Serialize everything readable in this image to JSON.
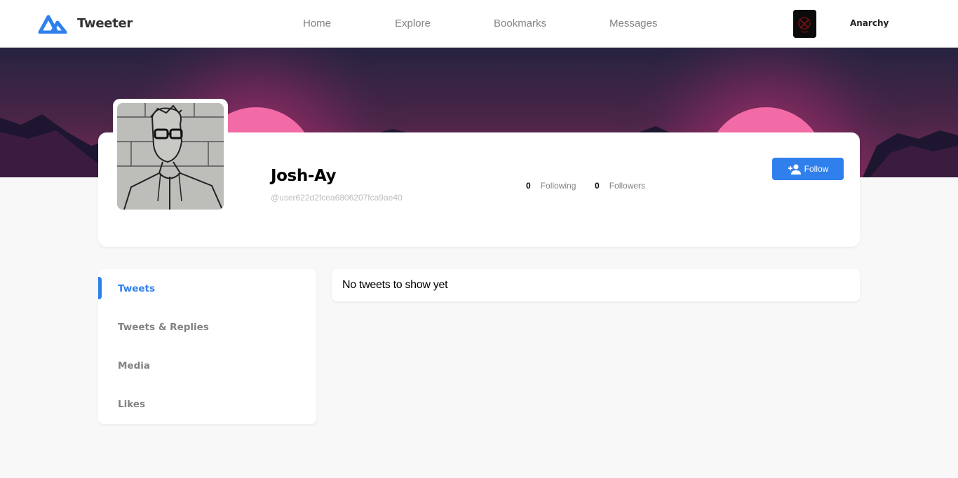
{
  "app": {
    "name": "Tweeter"
  },
  "nav": {
    "items": [
      "Home",
      "Explore",
      "Bookmarks",
      "Messages"
    ]
  },
  "user": {
    "name": "Anarchy"
  },
  "profile": {
    "display_name": "Josh-Ay",
    "handle": "@user622d2fcea6806207fca9ae40",
    "following_count": "0",
    "following_label": "Following",
    "followers_count": "0",
    "followers_label": "Followers",
    "follow_label": "Follow"
  },
  "tabs": [
    "Tweets",
    "Tweets & Replies",
    "Media",
    "Likes"
  ],
  "tweets": {
    "empty_message": "No tweets to show yet"
  },
  "colors": {
    "accent": "#2f80ed",
    "background": "#f8f8f8",
    "muted": "#828282"
  },
  "icons": {
    "logo": "tweeter-logo-icon",
    "follow": "person-add-icon"
  }
}
